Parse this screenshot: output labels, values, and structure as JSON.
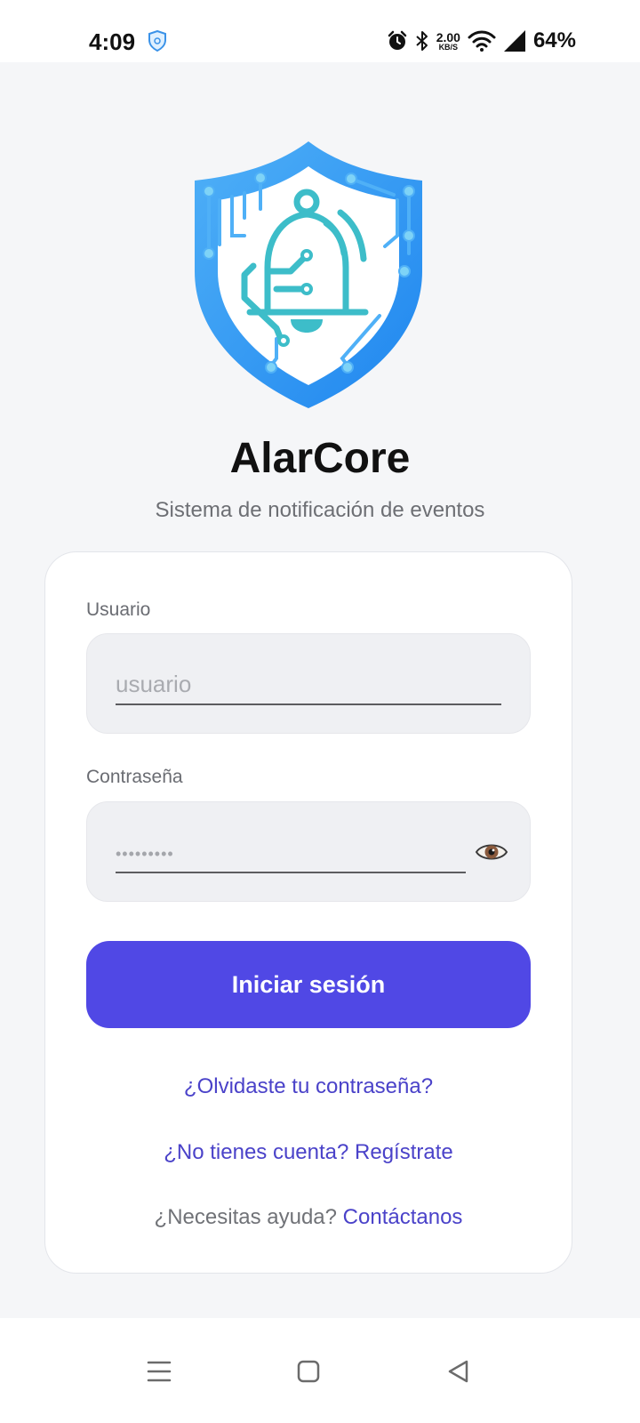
{
  "status_bar": {
    "time": "4:09",
    "net_speed_value": "2.00",
    "net_speed_unit": "KB/S",
    "battery": "64%",
    "icons": [
      "shield-icon",
      "alarm-icon",
      "bluetooth-icon",
      "wifi-icon",
      "signal-icon"
    ]
  },
  "app": {
    "name": "AlarCore",
    "subtitle": "Sistema de notificación de eventos"
  },
  "form": {
    "username_label": "Usuario",
    "username_placeholder": "usuario",
    "password_label": "Contraseña",
    "password_mask": "•••••••••",
    "submit_label": "Iniciar sesión"
  },
  "links": {
    "forgot": "¿Olvidaste tu contraseña?",
    "register": "¿No tienes cuenta? Regístrate",
    "help_prefix": "¿Necesitas ayuda?",
    "help_link": "Contáctanos"
  },
  "colors": {
    "accent": "#5048e5",
    "link": "#4a42c9",
    "logo_blue": "#2f8ff2",
    "logo_teal": "#3dbdc9",
    "background": "#f5f6f8"
  },
  "nav": {
    "icons": [
      "menu-icon",
      "home-icon",
      "back-icon"
    ]
  }
}
